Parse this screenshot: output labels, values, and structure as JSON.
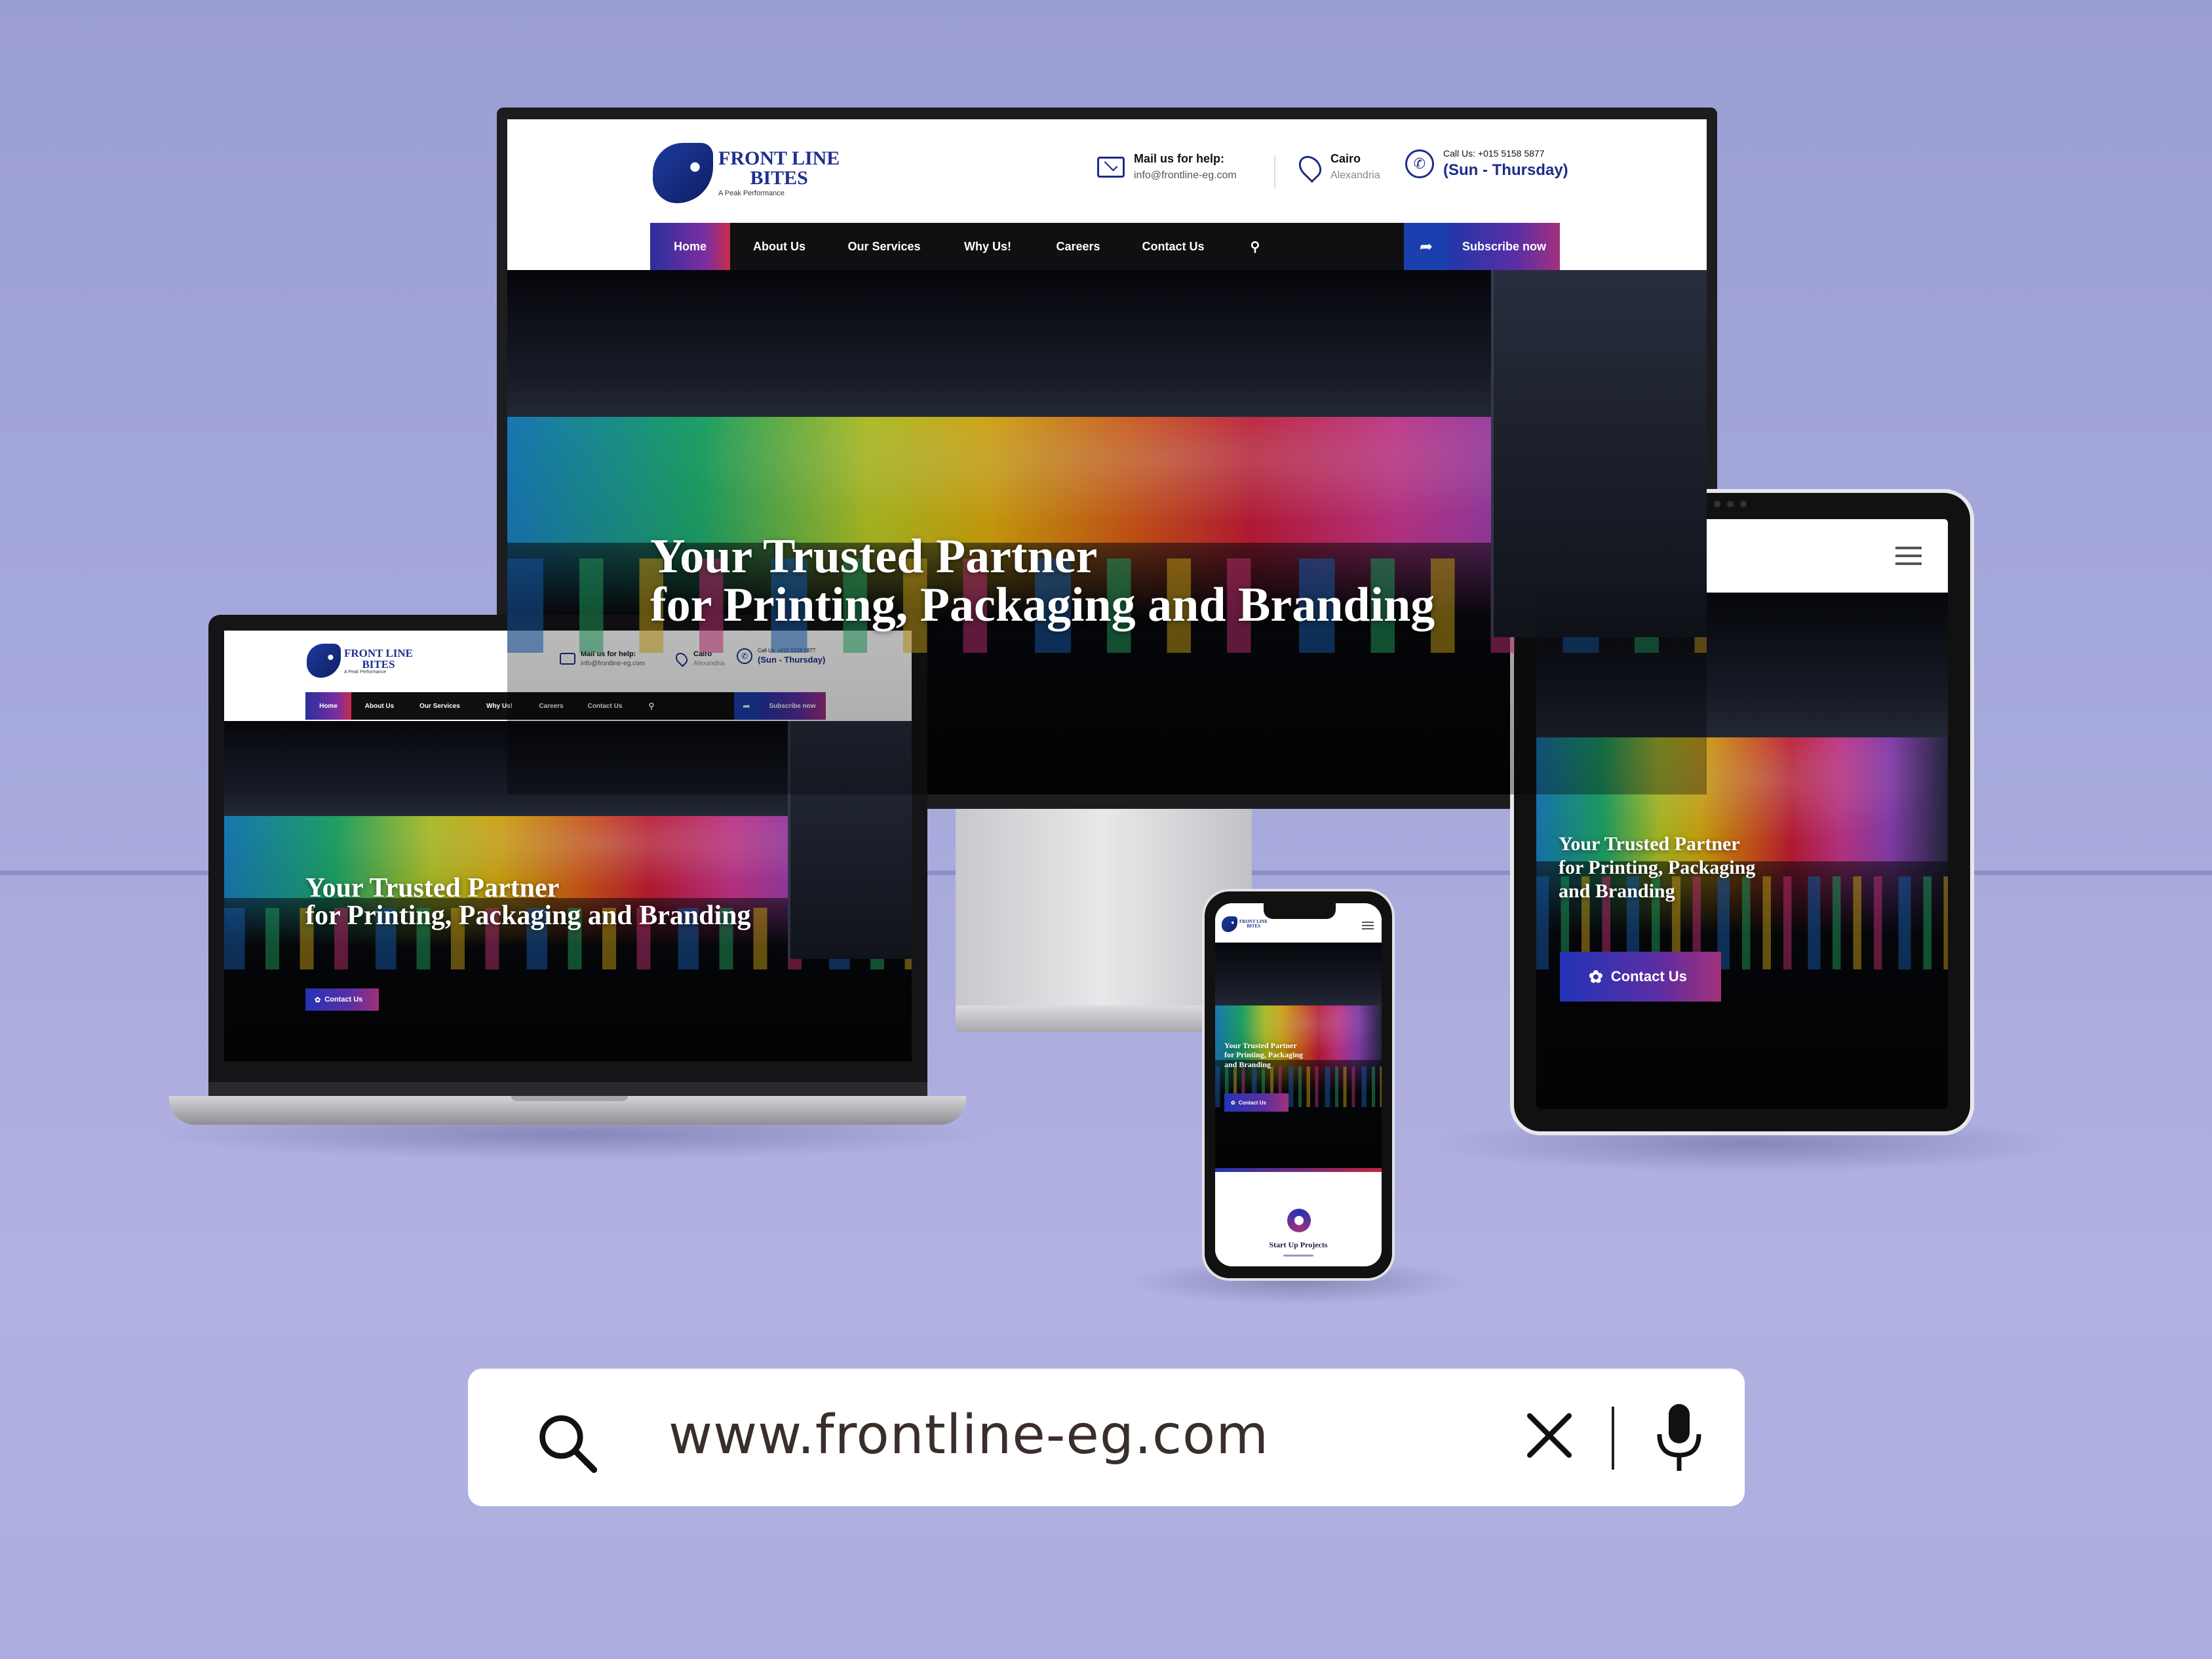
{
  "brand": {
    "name_line1": "FRONT LINE",
    "name_line2": "BITES",
    "tagline": "A Peak Performance"
  },
  "contact": {
    "mail_label": "Mail us for help:",
    "mail_value": "info@frontline-eg.com",
    "city": "Cairo",
    "city_sub": "Alexandria",
    "call_label": "Call Us: +015 5158 5877",
    "hours": "(Sun - Thursday)"
  },
  "nav": {
    "items": [
      "Home",
      "About Us",
      "Our Services",
      "Why Us!",
      "Careers",
      "Contact Us"
    ],
    "subscribe": "Subscribe now"
  },
  "hero": {
    "title_line1": "Your Trusted Partner",
    "title_line2": "for Printing, Packaging and Branding",
    "tablet_line1": "Your Trusted Partner",
    "tablet_line2": "for Printing, Packaging",
    "tablet_line3": "and Branding",
    "cta": "Contact Us"
  },
  "phone_section": {
    "label": "Start Up Projects"
  },
  "search": {
    "url": "www.frontline-eg.com"
  },
  "icons": {
    "mail": "mail-icon",
    "location": "location-pin-icon",
    "phone": "phone-icon",
    "search": "search-icon",
    "share": "share-arrow-icon",
    "menu": "hamburger-menu-icon",
    "clear": "close-icon",
    "mic": "microphone-icon"
  },
  "colors": {
    "brand_blue": "#1f2f8f",
    "nav_bg": "#101012",
    "accent_gradient_start": "#2234b7",
    "accent_gradient_end": "#a1307a",
    "background": "#a5a7d9"
  }
}
